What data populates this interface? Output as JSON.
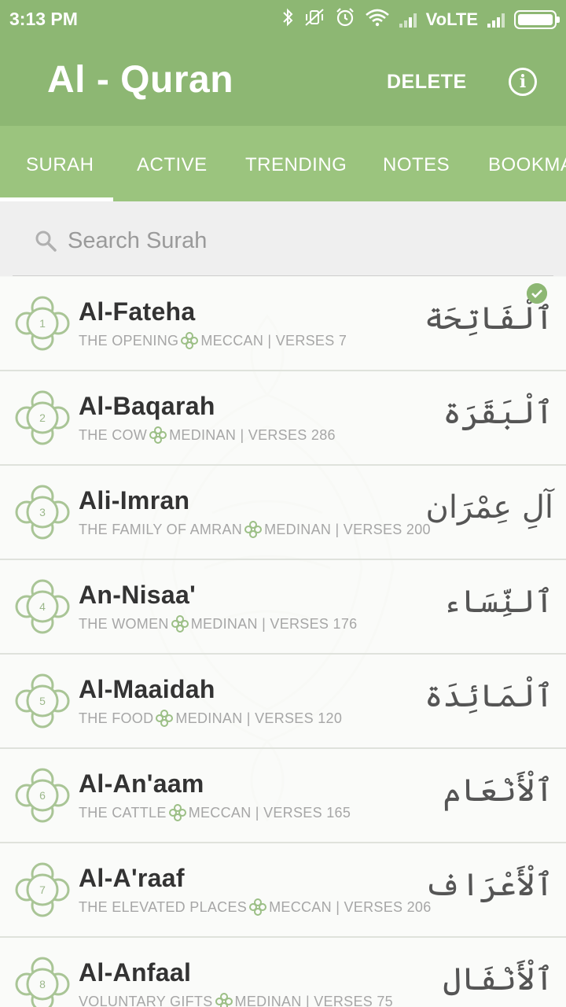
{
  "status_bar": {
    "time": "3:13 PM",
    "network_label": "VoLTE",
    "icons": [
      "bluetooth-icon",
      "vibrate-off-icon",
      "alarm-icon",
      "wifi-icon",
      "signal-icon",
      "battery-icon"
    ]
  },
  "app_bar": {
    "title": "Al - Quran",
    "delete_label": "DELETE",
    "info_icon": "info-icon",
    "info_glyph": "i"
  },
  "tabs": [
    {
      "label": "SURAH",
      "selected": true
    },
    {
      "label": "ACTIVE",
      "selected": false
    },
    {
      "label": "TRENDING",
      "selected": false
    },
    {
      "label": "NOTES",
      "selected": false
    },
    {
      "label": "BOOKMA",
      "selected": false
    }
  ],
  "search": {
    "placeholder": "Search Surah",
    "value": ""
  },
  "colors": {
    "primary": "#8db773",
    "tabs_bg": "#9bc47e",
    "accent_ornament": "#a9c596"
  },
  "surahs": [
    {
      "number": "1",
      "name": "Al-Fateha",
      "meaning": "THE OPENING",
      "info": "MECCAN | VERSES 7",
      "arabic": "ٱلْفَاتِحَة",
      "checked": true
    },
    {
      "number": "2",
      "name": "Al-Baqarah",
      "meaning": "THE COW",
      "info": "MEDINAN | VERSES 286",
      "arabic": "ٱلْبَقَرَة",
      "checked": false
    },
    {
      "number": "3",
      "name": "Ali-Imran",
      "meaning": "THE FAMILY OF AMRAN",
      "info": "MEDINAN | VERSES 200",
      "arabic": "آلِ عِمْرَان",
      "checked": false
    },
    {
      "number": "4",
      "name": "An-Nisaa'",
      "meaning": "THE WOMEN",
      "info": "MEDINAN | VERSES 176",
      "arabic": "ٱلنِّسَاء",
      "checked": false
    },
    {
      "number": "5",
      "name": "Al-Maaidah",
      "meaning": "THE FOOD",
      "info": "MEDINAN | VERSES 120",
      "arabic": "ٱلْمَائِدَة",
      "checked": false
    },
    {
      "number": "6",
      "name": "Al-An'aam",
      "meaning": "THE CATTLE",
      "info": "MECCAN | VERSES 165",
      "arabic": "ٱلْأَنْعَام",
      "checked": false
    },
    {
      "number": "7",
      "name": "Al-A'raaf",
      "meaning": "THE ELEVATED PLACES",
      "info": "MECCAN | VERSES 206",
      "arabic": "ٱلْأَعْرَاف",
      "checked": false
    },
    {
      "number": "8",
      "name": "Al-Anfaal",
      "meaning": "VOLUNTARY GIFTS",
      "info": "MEDINAN | VERSES 75",
      "arabic": "ٱلْأَنْفَال",
      "checked": false
    }
  ]
}
